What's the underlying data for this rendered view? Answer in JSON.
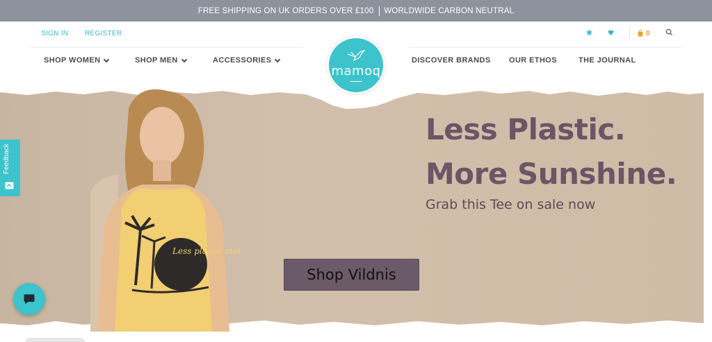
{
  "topbar": {
    "shipping_text": "FREE SHIPPING ON UK ORDERS OVER £100",
    "carbon_text": "WORLDWIDE CARBON NEUTRAL"
  },
  "account": {
    "sign_in": "SIGN IN",
    "register": "REGISTER"
  },
  "nav_left": [
    {
      "label": "SHOP WOMEN"
    },
    {
      "label": "SHOP MEN"
    },
    {
      "label": "ACCESSORIES"
    }
  ],
  "nav_right": [
    {
      "label": "DISCOVER BRANDS"
    },
    {
      "label": "OUR ETHOS"
    },
    {
      "label": "THE JOURNAL"
    }
  ],
  "logo": {
    "text": "mamoq"
  },
  "header_icons": {
    "star_icon": "star-icon",
    "heart_icon": "heart-icon",
    "bag_icon": "shopping-bag-icon",
    "bag_count": "0",
    "search_icon": "search-icon"
  },
  "hero": {
    "headline_line1": "Less Plastic.",
    "headline_line2": "More Sunshine.",
    "subheadline": "Grab this Tee on sale now",
    "cta_label": "Shop Vildnis",
    "tee_print": "Less plastic more fantastic"
  },
  "feedback": {
    "label": "Feedback"
  },
  "colors": {
    "brand_teal": "#3cc3cc",
    "topbar_gray": "#8d939c",
    "headline_purple": "#6b5566",
    "cta_bg": "#6b5a68",
    "hero_bg": "#cdb9a4"
  }
}
